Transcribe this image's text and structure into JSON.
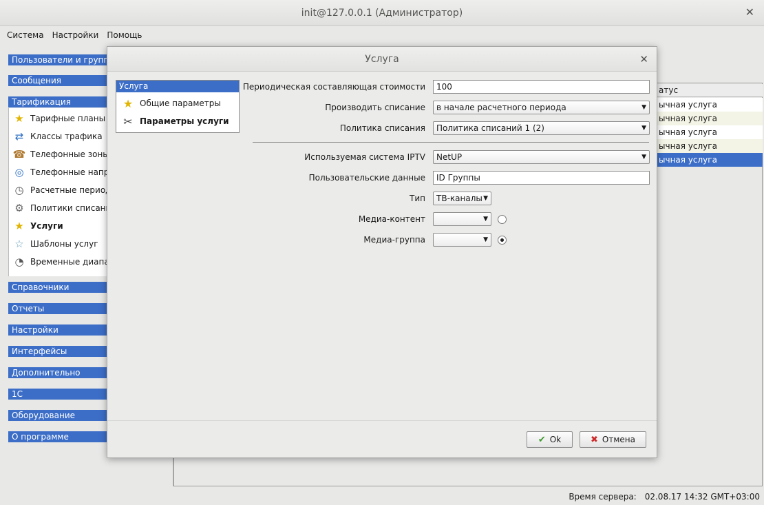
{
  "window": {
    "title": "init@127.0.0.1 (Администратор)",
    "close_glyph": "✕"
  },
  "menu": [
    "Система",
    "Настройки",
    "Помощь"
  ],
  "nav": {
    "categories_top": [
      "Пользователи и группы",
      "Сообщения",
      "Тарификация"
    ],
    "tarification_items": [
      {
        "label": "Тарифные планы",
        "icon": "tariff-plans-icon",
        "glyph": "★"
      },
      {
        "label": "Классы трафика",
        "icon": "traffic-classes-icon",
        "glyph": "⇄"
      },
      {
        "label": "Телефонные зоны",
        "icon": "phone-zones-icon",
        "glyph": "☎"
      },
      {
        "label": "Телефонные напр",
        "icon": "phone-directions-icon",
        "glyph": "◎"
      },
      {
        "label": "Расчетные период",
        "icon": "billing-periods-icon",
        "glyph": "◷"
      },
      {
        "label": "Политики списани",
        "icon": "charge-policies-icon",
        "glyph": "⚙"
      },
      {
        "label": "Услуги",
        "icon": "services-star-icon",
        "glyph": "★"
      },
      {
        "label": "Шаблоны услуг",
        "icon": "service-templates-icon",
        "glyph": "☆"
      },
      {
        "label": "Временные диапаз",
        "icon": "time-ranges-icon",
        "glyph": "◔"
      }
    ],
    "categories_bottom": [
      "Справочники",
      "Отчеты",
      "Настройки",
      "Интерфейсы",
      "Дополнительно",
      "1С",
      "Оборудование",
      "О программе"
    ]
  },
  "table": {
    "header": "атус",
    "rows": [
      "ычная услуга",
      "ычная услуга",
      "ычная услуга",
      "ычная услуга",
      "ычная услуга"
    ]
  },
  "status": {
    "label": "Время сервера:",
    "value": "02.08.17 14:32 GMT+03:00"
  },
  "dialog": {
    "title": "Услуга",
    "close_glyph": "✕",
    "tree": {
      "root": "Услуга",
      "items": [
        {
          "label": "Общие параметры",
          "glyph": "★"
        },
        {
          "label": "Параметры услуги",
          "glyph": "✂"
        }
      ]
    },
    "fields": {
      "periodic_cost": {
        "label": "Периодическая составляющая стоимости",
        "value": "100"
      },
      "charge_mode": {
        "label": "Производить списание",
        "value": "в начале расчетного периода"
      },
      "charge_policy": {
        "label": "Политика списания",
        "value": "Политика списаний 1 (2)"
      },
      "iptv_system": {
        "label": "Используемая система IPTV",
        "value": "NetUP"
      },
      "user_data": {
        "label": "Пользовательские данные",
        "value": "ID Группы"
      },
      "type": {
        "label": "Тип",
        "value": "ТВ-каналы"
      },
      "media_content": {
        "label": "Медиа-контент",
        "value": ""
      },
      "media_group": {
        "label": "Медиа-группа",
        "value": ""
      }
    },
    "buttons": {
      "ok": {
        "label": "Ok",
        "glyph": "✔",
        "color": "#3a9a2a"
      },
      "cancel": {
        "label": "Отмена",
        "glyph": "✖",
        "color": "#cc2a2a"
      }
    },
    "combo_arrow": "▼"
  }
}
